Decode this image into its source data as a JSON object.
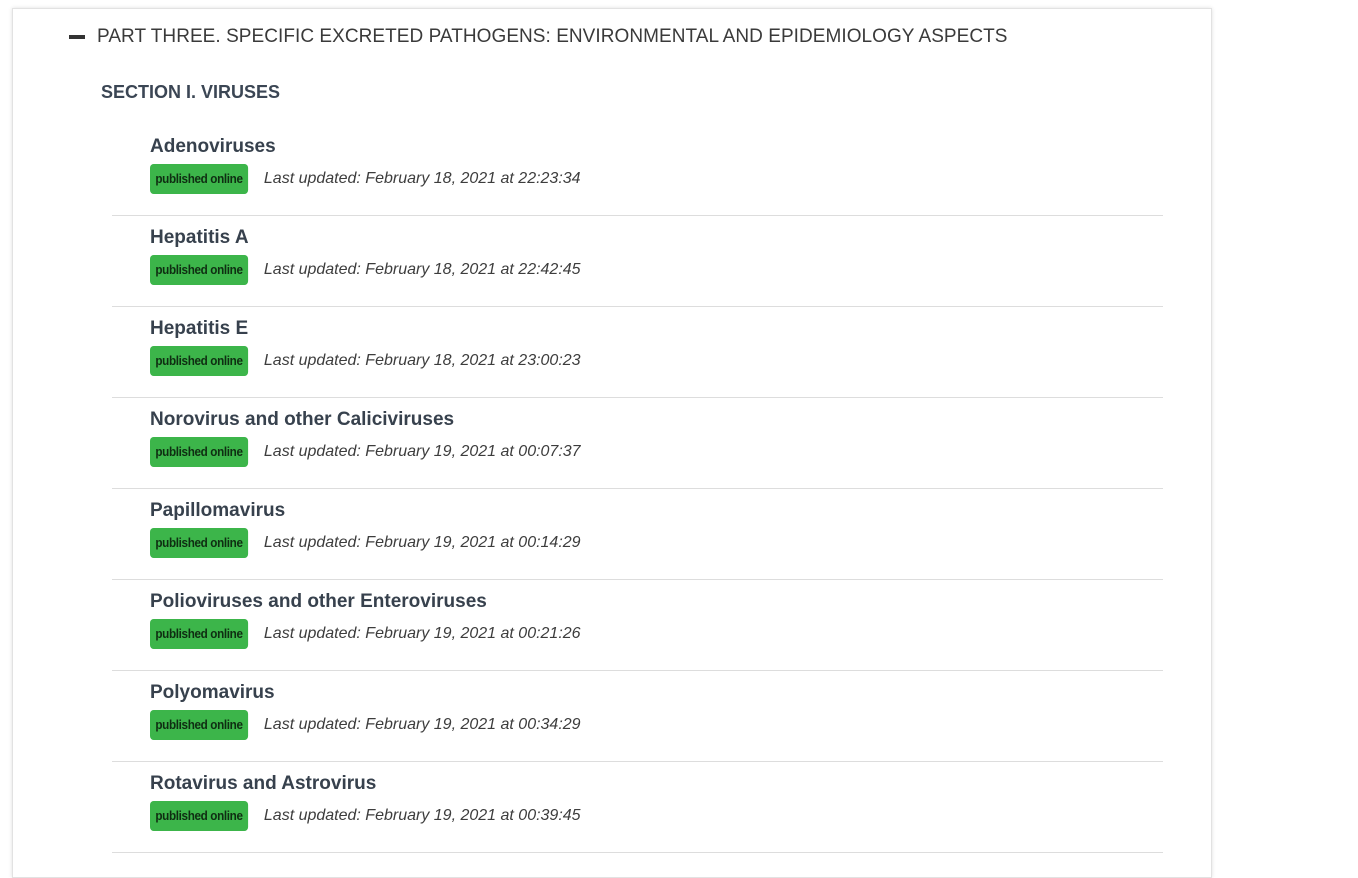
{
  "part": {
    "title": "PART THREE. SPECIFIC EXCRETED PATHOGENS: ENVIRONMENTAL AND EPIDEMIOLOGY ASPECTS",
    "icon": "minus-icon"
  },
  "section": {
    "title": "SECTION I. VIRUSES"
  },
  "status_color": "#3cb54a",
  "chapters": [
    {
      "title": "Adenoviruses",
      "status": "published online",
      "updated": "Last updated: February 18, 2021 at 22:23:34"
    },
    {
      "title": "Hepatitis A",
      "status": "published online",
      "updated": "Last updated: February 18, 2021 at 22:42:45"
    },
    {
      "title": "Hepatitis E",
      "status": "published online",
      "updated": "Last updated: February 18, 2021 at 23:00:23"
    },
    {
      "title": "Norovirus and other Caliciviruses",
      "status": "published online",
      "updated": "Last updated: February 19, 2021 at 00:07:37"
    },
    {
      "title": "Papillomavirus",
      "status": "published online",
      "updated": "Last updated: February 19, 2021 at 00:14:29"
    },
    {
      "title": "Polioviruses and other Enteroviruses",
      "status": "published online",
      "updated": "Last updated: February 19, 2021 at 00:21:26"
    },
    {
      "title": "Polyomavirus",
      "status": "published online",
      "updated": "Last updated: February 19, 2021 at 00:34:29"
    },
    {
      "title": "Rotavirus and Astrovirus",
      "status": "published online",
      "updated": "Last updated: February 19, 2021 at 00:39:45"
    }
  ]
}
